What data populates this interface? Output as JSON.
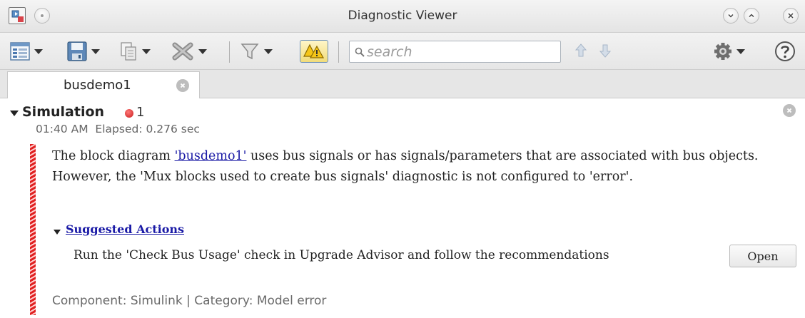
{
  "window": {
    "title": "Diagnostic Viewer"
  },
  "toolbar": {
    "search_placeholder": "search"
  },
  "tabs": [
    {
      "label": "busdemo1"
    }
  ],
  "entry": {
    "title": "Simulation",
    "error_count": "1",
    "timestamp": "01:40 AM  Elapsed: 0.276 sec",
    "message_before_link": "The block diagram ",
    "model_link": "'busdemo1'",
    "message_after_link": " uses bus signals or has signals/parameters that are associated with bus objects. However, the 'Mux blocks used to create bus signals' diagnostic is not configured to 'error'.",
    "suggested_actions_label": "Suggested Actions",
    "suggested_action_text": "Run the 'Check Bus Usage' check in Upgrade Advisor and follow the recommendations",
    "open_button": "Open",
    "component_line": "Component: Simulink | Category: Model error"
  },
  "colors": {
    "error": "#d32020",
    "link": "#1a1aa6",
    "warning_toggle": "#f1dc7a"
  }
}
